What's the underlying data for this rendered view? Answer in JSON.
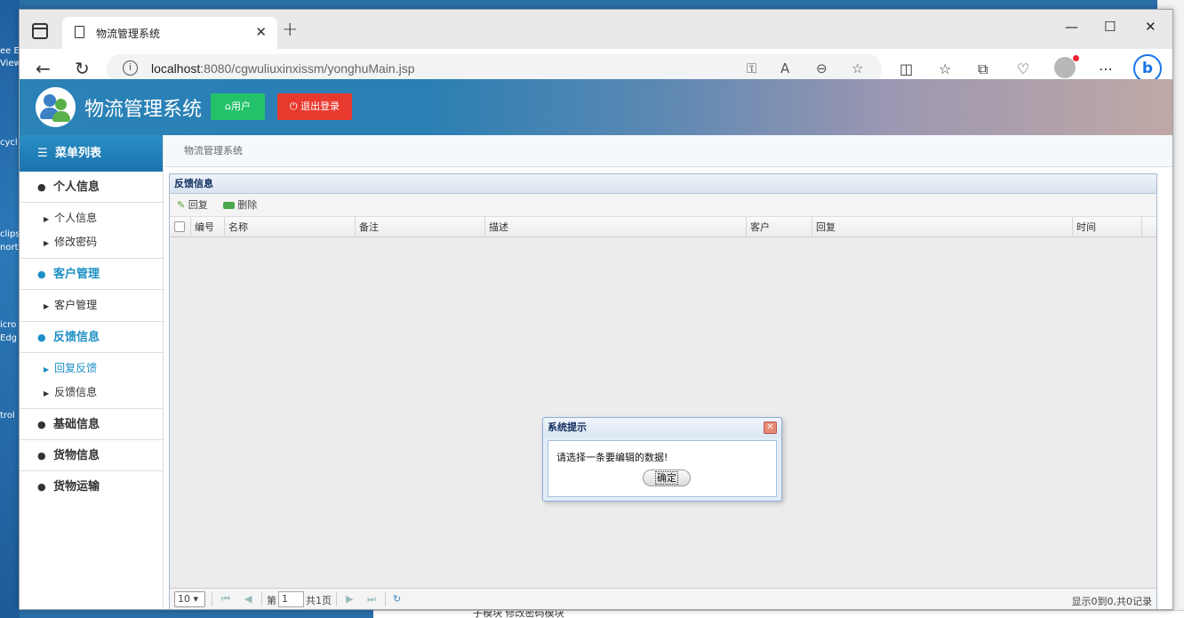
{
  "desktop": {
    "icons": [
      "ee E",
      "View",
      "cycl",
      "clips",
      "nort",
      "icro",
      "Edg",
      "trol"
    ],
    "bottom_text": "子模块 修改密码模块"
  },
  "browser": {
    "tab_title": "物流管理系统",
    "url_host": "localhost",
    "url_rest": ":8080/cgwuliuxinxissm/yonghuMain.jsp",
    "new_tab": "+",
    "minimize": "—",
    "maximize": "☐",
    "close": "✕"
  },
  "header": {
    "title": "物流管理系统",
    "user_button": "用户",
    "logout_button": "退出登录"
  },
  "sidebar": {
    "heading": "菜单列表",
    "sections": [
      {
        "label": "个人信息",
        "items": [
          "个人信息",
          "修改密码"
        ]
      },
      {
        "label": "客户管理",
        "items": [
          "客户管理"
        ]
      },
      {
        "label": "反馈信息",
        "items": [
          "回复反馈",
          "反馈信息"
        ]
      },
      {
        "label": "基础信息"
      },
      {
        "label": "货物信息"
      },
      {
        "label": "货物运输"
      }
    ]
  },
  "breadcrumb": "物流管理系统",
  "panel": {
    "title": "反馈信息",
    "toolbar": {
      "reply": "回复",
      "delete": "删除"
    },
    "columns": [
      "编号",
      "名称",
      "备注",
      "描述",
      "客户",
      "回复",
      "时间"
    ]
  },
  "pager": {
    "page_size": "10",
    "page_prefix": "第",
    "page_value": "1",
    "page_suffix": "共1页",
    "info": "显示0到0,共0记录"
  },
  "dialog": {
    "title": "系统提示",
    "message": "请选择一条要编辑的数据!",
    "ok": "确定"
  }
}
